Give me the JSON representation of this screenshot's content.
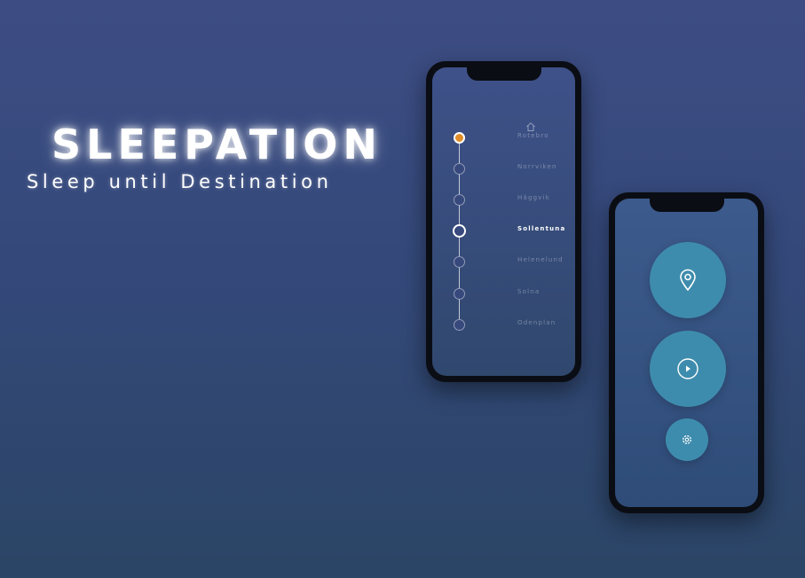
{
  "brand": {
    "title": "SLEEPATION",
    "subtitle": "Sleep until Destination"
  },
  "route_screen": {
    "destination_icon": "home-icon",
    "stops": [
      {
        "name": "Rotebro",
        "state": "start",
        "accent": "#e08e2b"
      },
      {
        "name": "Norrviken",
        "state": "upcoming"
      },
      {
        "name": "Häggvik",
        "state": "upcoming"
      },
      {
        "name": "Sollentuna",
        "state": "current"
      },
      {
        "name": "Helenelund",
        "state": "upcoming"
      },
      {
        "name": "Solna",
        "state": "upcoming"
      },
      {
        "name": "Odenplan",
        "state": "upcoming"
      }
    ]
  },
  "home_screen": {
    "buttons": [
      {
        "icon": "location-pin-icon",
        "action": "set-destination"
      },
      {
        "icon": "play-icon",
        "action": "start"
      },
      {
        "icon": "gear-icon",
        "action": "settings"
      }
    ]
  },
  "colors": {
    "background_top": "#3d4d84",
    "background_bottom": "#2b4566",
    "button": "#3e8cad",
    "start_marker": "#e08e2b"
  }
}
